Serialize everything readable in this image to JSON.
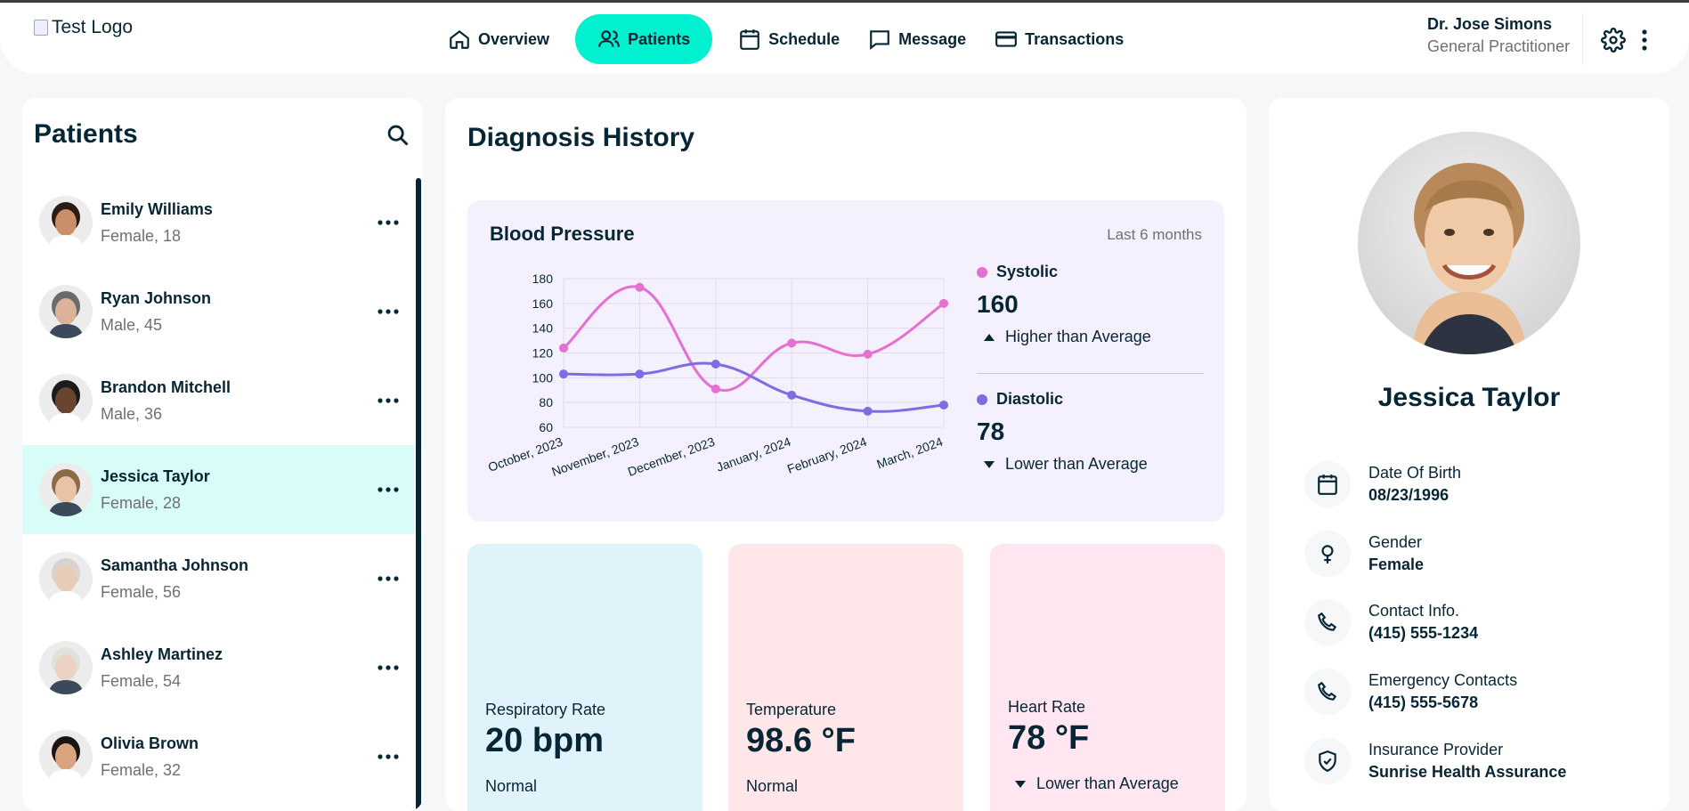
{
  "header": {
    "logo_alt": "Test Logo",
    "nav": [
      {
        "label": "Overview",
        "icon": "home-icon"
      },
      {
        "label": "Patients",
        "icon": "users-icon",
        "active": true
      },
      {
        "label": "Schedule",
        "icon": "calendar-icon"
      },
      {
        "label": "Message",
        "icon": "chat-icon"
      },
      {
        "label": "Transactions",
        "icon": "credit-card-icon"
      }
    ],
    "doctor_name": "Dr. Jose Simons",
    "doctor_role": "General Practitioner"
  },
  "patients": {
    "title": "Patients",
    "list": [
      {
        "name": "Emily Williams",
        "sub": "Female, 18"
      },
      {
        "name": "Ryan Johnson",
        "sub": "Male, 45"
      },
      {
        "name": "Brandon Mitchell",
        "sub": "Male, 36"
      },
      {
        "name": "Jessica Taylor",
        "sub": "Female, 28",
        "active": true
      },
      {
        "name": "Samantha Johnson",
        "sub": "Female, 56"
      },
      {
        "name": "Ashley Martinez",
        "sub": "Female, 54"
      },
      {
        "name": "Olivia Brown",
        "sub": "Female, 32"
      }
    ]
  },
  "diagnosis": {
    "title": "Diagnosis History",
    "bp_title": "Blood Pressure",
    "bp_range": "Last 6 months",
    "systolic": {
      "label": "Systolic",
      "value": "160",
      "note": "Higher than Average",
      "color": "#e66fd2"
    },
    "diastolic": {
      "label": "Diastolic",
      "value": "78",
      "note": "Lower than Average",
      "color": "#8c6fe6"
    },
    "vitals": [
      {
        "label": "Respiratory Rate",
        "value": "20 bpm",
        "status": "Normal",
        "color": "#e0f3fa"
      },
      {
        "label": "Temperature",
        "value": "98.6 °F",
        "status": "Normal",
        "color": "#ffe6e9"
      },
      {
        "label": "Heart Rate",
        "value": "78 °F",
        "status": "Lower than Average",
        "color": "#ffe6f1"
      }
    ]
  },
  "chart_data": {
    "type": "line",
    "categories": [
      "October, 2023",
      "November, 2023",
      "December, 2023",
      "January, 2024",
      "February, 2024",
      "March, 2024"
    ],
    "series": [
      {
        "name": "Systolic",
        "values": [
          124,
          173,
          91,
          128,
          119,
          160
        ],
        "color": "#e66fd2"
      },
      {
        "name": "Diastolic",
        "values": [
          103,
          103,
          111,
          86,
          73,
          78
        ],
        "color": "#7e6ce4"
      }
    ],
    "ylim": [
      60,
      180
    ],
    "yticks": [
      60,
      80,
      100,
      120,
      140,
      160,
      180
    ],
    "grid": true
  },
  "profile": {
    "name": "Jessica Taylor",
    "fields": [
      {
        "label": "Date Of Birth",
        "value": "08/23/1996",
        "icon": "calendar-icon"
      },
      {
        "label": "Gender",
        "value": "Female",
        "icon": "female-icon"
      },
      {
        "label": "Contact Info.",
        "value": "(415) 555-1234",
        "icon": "phone-icon"
      },
      {
        "label": "Emergency Contacts",
        "value": "(415) 555-5678",
        "icon": "phone-icon"
      },
      {
        "label": "Insurance Provider",
        "value": "Sunrise Health Assurance",
        "icon": "shield-icon"
      }
    ]
  }
}
